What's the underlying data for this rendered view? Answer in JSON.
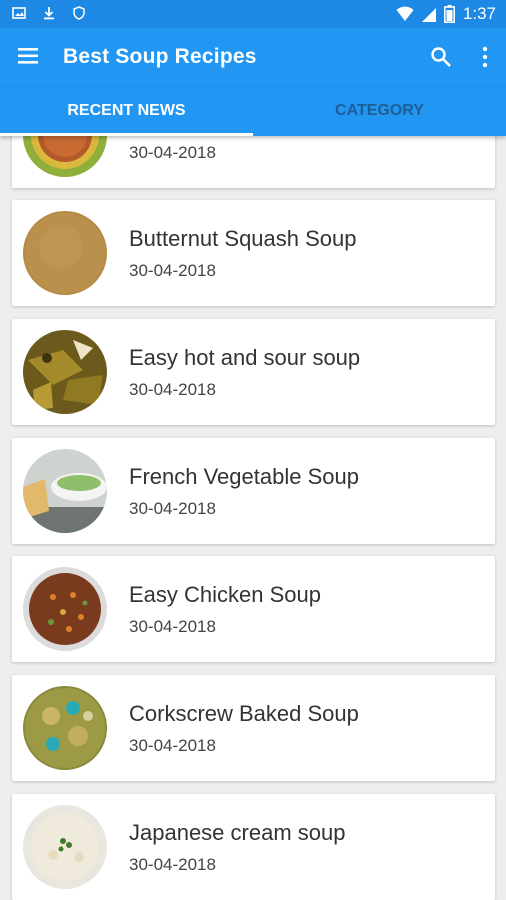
{
  "status_bar": {
    "time": "1:37",
    "icons": [
      "image-icon",
      "download-icon",
      "shield-icon",
      "wifi-icon",
      "signal-icon",
      "battery-icon"
    ]
  },
  "app_bar": {
    "title": "Best Soup Recipes",
    "icons": [
      "menu-icon",
      "search-icon",
      "more-vert-icon"
    ]
  },
  "tabs": [
    {
      "label": "RECENT NEWS",
      "selected": true
    },
    {
      "label": "CATEGORY",
      "selected": false
    }
  ],
  "colors": {
    "status_bar": "#1e88e5",
    "app_bar": "#2196f3",
    "tab_inactive_text": "#1e5e95",
    "background": "#eeeeee"
  },
  "recipes": [
    {
      "title": "",
      "date": "30-04-2018"
    },
    {
      "title": "Butternut Squash Soup",
      "date": "30-04-2018"
    },
    {
      "title": "Easy hot and sour soup",
      "date": "30-04-2018"
    },
    {
      "title": "French Vegetable Soup",
      "date": "30-04-2018"
    },
    {
      "title": "Easy Chicken Soup",
      "date": "30-04-2018"
    },
    {
      "title": "Corkscrew Baked Soup",
      "date": "30-04-2018"
    },
    {
      "title": "Japanese cream soup",
      "date": "30-04-2018"
    }
  ]
}
